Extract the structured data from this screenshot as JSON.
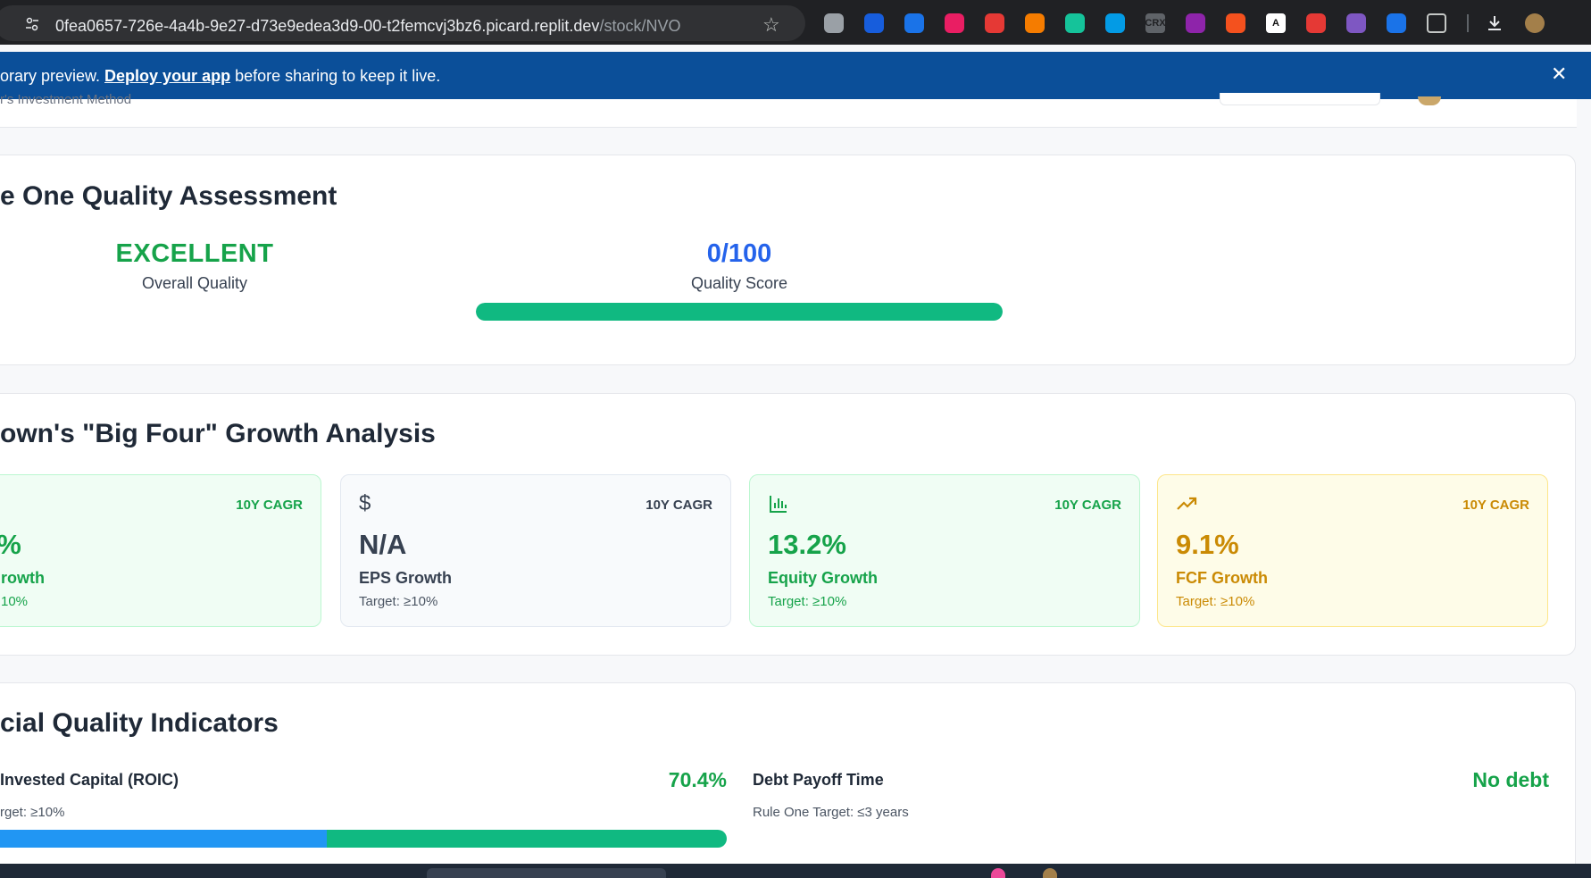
{
  "browser": {
    "url_host": "0fea0657-726e-4a4b-9e27-d73e9edea3d9-00-t2femcvj3bz6.picard.replit.dev",
    "url_path": "/stock/NVO",
    "extensions": [
      {
        "icon": "camera-icon",
        "color": "#9aa0a6",
        "label": ""
      },
      {
        "icon": "bitwarden-icon",
        "color": "#175ddc",
        "label": ""
      },
      {
        "icon": "screenshot-icon",
        "color": "#1a73e8",
        "label": ""
      },
      {
        "icon": "no-entry-icon",
        "color": "#e91e63",
        "label": ""
      },
      {
        "icon": "pokeball-icon",
        "color": "#e53935",
        "label": ""
      },
      {
        "icon": "fox-icon",
        "color": "#f57c00",
        "label": ""
      },
      {
        "icon": "grammarly-icon",
        "color": "#15c39a",
        "label": ""
      },
      {
        "icon": "cloud-download-icon",
        "color": "#039be5",
        "label": ""
      },
      {
        "icon": "crx-icon",
        "color": "#5f6368",
        "label": "CRX"
      },
      {
        "icon": "letter-n-icon",
        "color": "#8e24aa",
        "label": ""
      },
      {
        "icon": "hand-icon",
        "color": "#f4511e",
        "label": ""
      },
      {
        "icon": "letter-a-icon",
        "color": "#111111",
        "label": "A"
      },
      {
        "icon": "chat-icon",
        "color": "#e53935",
        "label": ""
      },
      {
        "icon": "ghost-icon",
        "color": "#7e57c2",
        "label": ""
      },
      {
        "icon": "puzzle-icon",
        "color": "#1a73e8",
        "label": ""
      },
      {
        "icon": "extensions-icon",
        "color": "#c4c7c5",
        "label": ""
      }
    ]
  },
  "banner": {
    "prefix": "orary preview. ",
    "link": "Deploy your app",
    "suffix": " before sharing to keep it live."
  },
  "header": {
    "subtitle": "r's Investment Method"
  },
  "quality": {
    "title": "e One Quality Assessment",
    "rating": "EXCELLENT",
    "rating_label": "Overall Quality",
    "score": "0/100",
    "score_label": "Quality Score",
    "bar_fill_percent": 100,
    "colors": {
      "rating": "#16a34a",
      "score": "#2563eb",
      "bar": "#10b981"
    }
  },
  "growth": {
    "title": "own's \"Big Four\" Growth Analysis",
    "tiles": [
      {
        "icon": "",
        "cagr": "10Y CAGR",
        "value": "5%",
        "name": "rowth",
        "target": "10%",
        "theme": "green"
      },
      {
        "icon": "dollar-icon",
        "cagr": "10Y CAGR",
        "value": "N/A",
        "name": "EPS Growth",
        "target": "Target: ≥10%",
        "theme": "gray"
      },
      {
        "icon": "bar-chart-icon",
        "cagr": "10Y CAGR",
        "value": "13.2%",
        "name": "Equity Growth",
        "target": "Target: ≥10%",
        "theme": "green"
      },
      {
        "icon": "trending-up-icon",
        "cagr": "10Y CAGR",
        "value": "9.1%",
        "name": "FCF Growth",
        "target": "Target: ≥10%",
        "theme": "yellow"
      }
    ]
  },
  "indicators": {
    "title": "cial Quality Indicators",
    "roic": {
      "label": "Invested Capital (ROIC)",
      "value": "70.4%",
      "target": "rget: ≥10%",
      "bar_fill_percent": 100
    },
    "debt": {
      "label": "Debt Payoff Time",
      "value": "No debt",
      "target": "Rule One Target: ≤3 years"
    }
  }
}
